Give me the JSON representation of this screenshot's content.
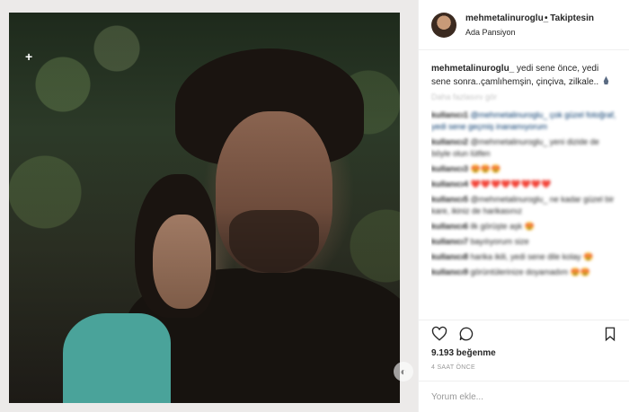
{
  "post": {
    "username": "mehmetalinuroglu_",
    "follow_status": "• Takiptesin",
    "location": "Ada Pansiyon",
    "caption_user": "mehmetalinuroglu_",
    "caption_text": "yedi sene önce, yedi sene sonra..çamlıhemşin, çinçiva, zilkale..",
    "translate_label": "Daha fazlasını gör",
    "likes": "9.193 beğenme",
    "time": "4 SAAT ÖNCE",
    "comment_placeholder": "Yorum ekle..."
  },
  "comments": [
    {
      "user": "kullanıcı1",
      "text": "@mehmetalinuroglu_ çok güzel fotoğraf, yedi sene geçmiş inanamıyorum"
    },
    {
      "user": "kullanıcı2",
      "text": "@mehmetalinuroglu_ yeni dizide de böyle olun lütfen"
    },
    {
      "user": "kullanıcı3",
      "text": "😍😍😍"
    },
    {
      "user": "kullanıcı4",
      "text": "❤️❤️❤️❤️❤️❤️❤️❤️"
    },
    {
      "user": "kullanıcı5",
      "text": "@mehmetalinuroglu_ ne kadar güzel bir kare, ikiniz de harikasınız"
    },
    {
      "user": "kullanıcı6",
      "text": "ilk görüşte aşk 😍"
    },
    {
      "user": "kullanıcı7",
      "text": "bayılıyorum size"
    },
    {
      "user": "kullanıcı8",
      "text": "harika ikili, yedi sene dile kolay 😍"
    },
    {
      "user": "kullanıcı9",
      "text": "görüntülerinize doyamadım 😍😍"
    }
  ],
  "icons": {
    "like": "heart-icon",
    "comment": "comment-icon",
    "save": "bookmark-icon"
  },
  "colors": {
    "text": "#262626",
    "muted": "#999999",
    "mention": "#003569",
    "border": "#efefef"
  }
}
